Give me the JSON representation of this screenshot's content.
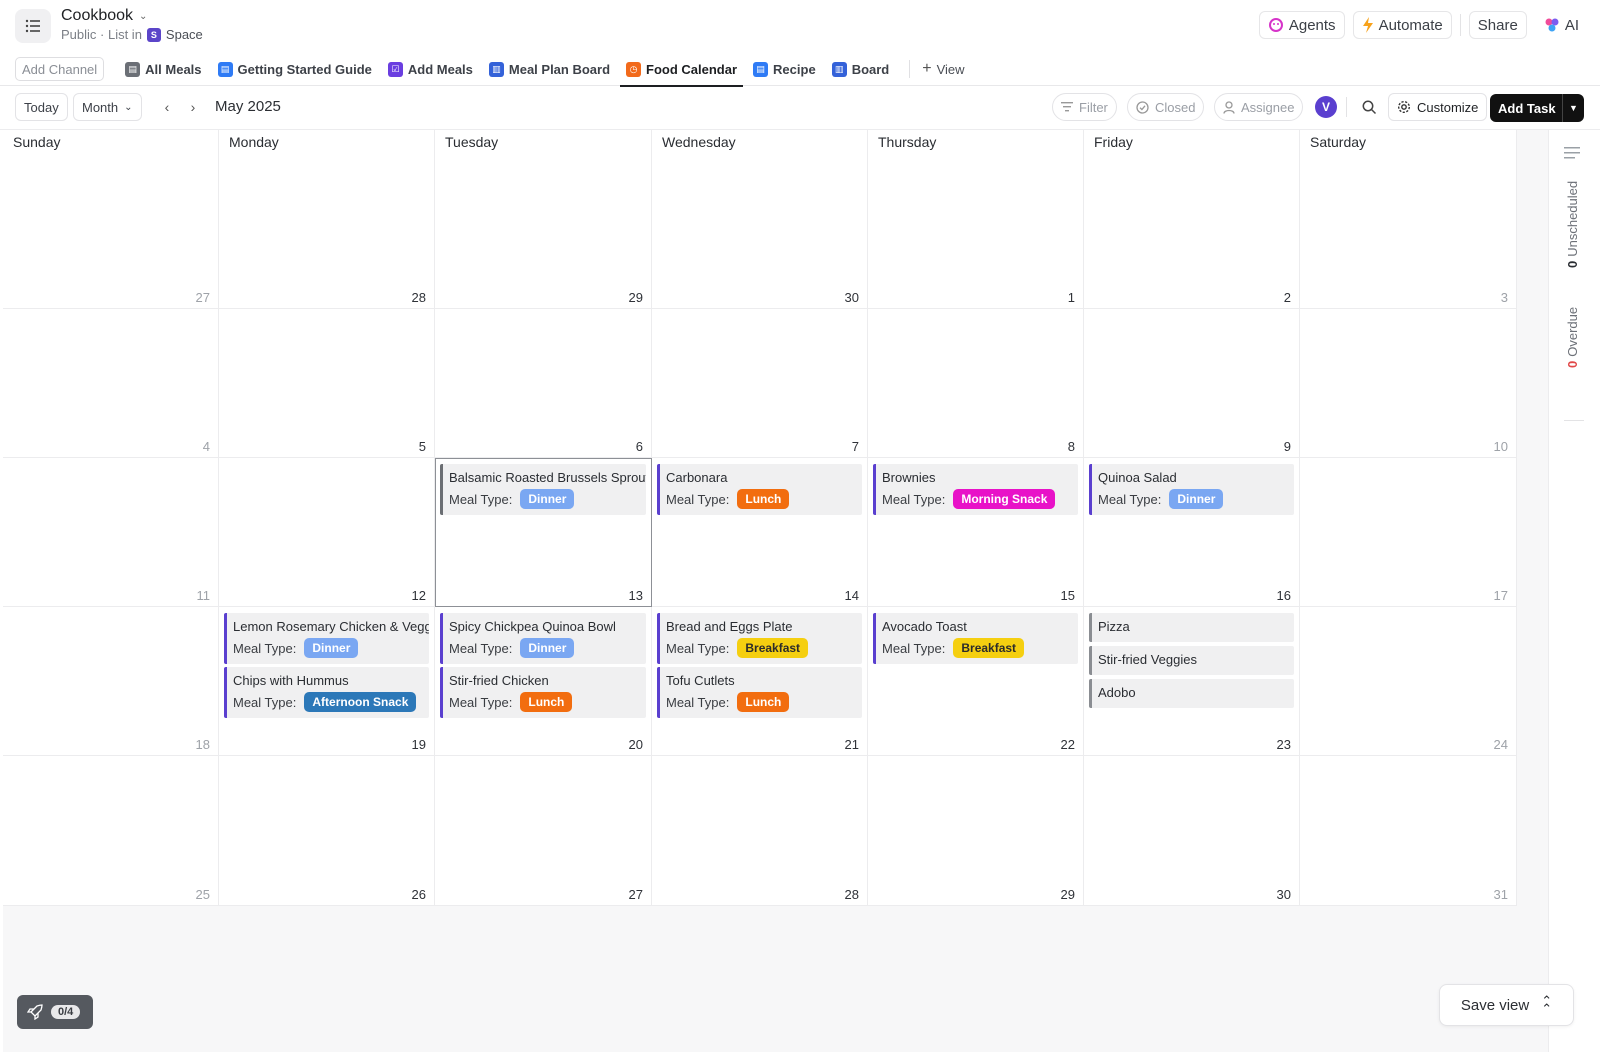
{
  "header": {
    "title": "Cookbook",
    "subtitle_prefix": "Public · List in",
    "space_badge": "S",
    "space_name": "Space",
    "buttons": {
      "agents": "Agents",
      "automate": "Automate",
      "share": "Share",
      "ai": "AI"
    }
  },
  "tabs": {
    "add_channel": "Add Channel",
    "items": [
      {
        "label": "All Meals",
        "color": "#6b6f76"
      },
      {
        "label": "Getting Started Guide",
        "color": "#2f7bf5"
      },
      {
        "label": "Add Meals",
        "color": "#6a3ee0"
      },
      {
        "label": "Meal Plan Board",
        "color": "#3462d9"
      },
      {
        "label": "Food Calendar",
        "color": "#f26a1b",
        "active": true
      },
      {
        "label": "Recipe",
        "color": "#2f7bf5"
      },
      {
        "label": "Board",
        "color": "#3462d9"
      }
    ],
    "add_view": "View"
  },
  "toolbar": {
    "today": "Today",
    "month": "Month",
    "period": "May 2025",
    "filter": "Filter",
    "closed": "Closed",
    "assignee": "Assignee",
    "avatar_initial": "V",
    "customize": "Customize",
    "add_task": "Add Task"
  },
  "calendar": {
    "weekdays": [
      "Sunday",
      "Monday",
      "Tuesday",
      "Wednesday",
      "Thursday",
      "Friday",
      "Saturday"
    ],
    "weeks": [
      [
        "27",
        "28",
        "29",
        "30",
        "1",
        "2",
        "3"
      ],
      [
        "4",
        "5",
        "6",
        "7",
        "8",
        "9",
        "10"
      ],
      [
        "11",
        "12",
        "13",
        "14",
        "15",
        "16",
        "17"
      ],
      [
        "18",
        "19",
        "20",
        "21",
        "22",
        "23",
        "24"
      ],
      [
        "25",
        "26",
        "27",
        "28",
        "29",
        "30",
        "31"
      ]
    ],
    "faded_days": [
      "27",
      "3",
      "4",
      "10",
      "11",
      "17",
      "18",
      "24",
      "25",
      "31"
    ],
    "meal_label": "Meal Type:",
    "meal_colors": {
      "Dinner": "#7aa7f2",
      "Lunch": "#f26d0f",
      "Morning Snack": "#e812c8",
      "Breakfast": "#f5cf10",
      "Afternoon Snack": "#2c78b8"
    },
    "events": [
      {
        "week": 2,
        "day": 2,
        "title": "Balsamic Roasted Brussels Sprouts",
        "meal": "Dinner",
        "slot": 0,
        "color": "#6b6e73"
      },
      {
        "week": 2,
        "day": 3,
        "title": "Carbonara",
        "meal": "Lunch",
        "slot": 0
      },
      {
        "week": 2,
        "day": 4,
        "title": "Brownies",
        "meal": "Morning Snack",
        "slot": 0
      },
      {
        "week": 2,
        "day": 5,
        "title": "Quinoa Salad",
        "meal": "Dinner",
        "slot": 0
      },
      {
        "week": 3,
        "day": 1,
        "title": "Lemon Rosemary Chicken & Veggies",
        "meal": "Dinner",
        "slot": 0
      },
      {
        "week": 3,
        "day": 1,
        "title": "Chips with Hummus",
        "meal": "Afternoon Snack",
        "slot": 1
      },
      {
        "week": 3,
        "day": 2,
        "title": "Spicy Chickpea Quinoa Bowl",
        "meal": "Dinner",
        "slot": 0
      },
      {
        "week": 3,
        "day": 2,
        "title": "Stir-fried Chicken",
        "meal": "Lunch",
        "slot": 1
      },
      {
        "week": 3,
        "day": 3,
        "title": "Bread and Eggs Plate",
        "meal": "Breakfast",
        "slot": 0
      },
      {
        "week": 3,
        "day": 3,
        "title": "Tofu Cutlets",
        "meal": "Lunch",
        "slot": 1
      },
      {
        "week": 3,
        "day": 4,
        "title": "Avocado Toast",
        "meal": "Breakfast",
        "slot": 0
      },
      {
        "week": 3,
        "day": 5,
        "title": "Pizza",
        "meal": null,
        "slot": 0
      },
      {
        "week": 3,
        "day": 5,
        "title": "Stir-fried Veggies",
        "meal": null,
        "slot": 1
      },
      {
        "week": 3,
        "day": 5,
        "title": "Adobo",
        "meal": null,
        "slot": 2
      }
    ]
  },
  "rail": {
    "unscheduled_count": "0",
    "unscheduled_label": "Unscheduled",
    "overdue_count": "0",
    "overdue_label": "Overdue"
  },
  "footer": {
    "progress": "0/4",
    "save_view": "Save view"
  }
}
